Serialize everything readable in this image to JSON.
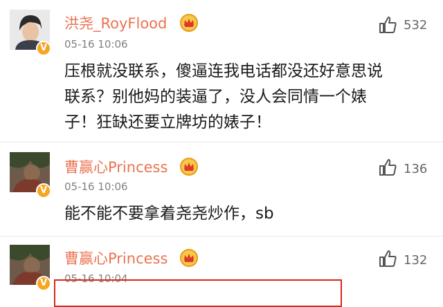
{
  "comments": [
    {
      "username": "洪尧_RoyFlood",
      "time": "05-16 10:06",
      "likes": "532",
      "text_lines": [
        "压根就没联系，傻逼连我电话都没还好意思说",
        "联系？别他妈的装逼了，没人会同情一个婊",
        "子！狂缺还要立牌坊的婊子！"
      ],
      "verified_icon": "verified-v-badge",
      "vip_icon": "crown-badge-icon"
    },
    {
      "username": "曹赢心Princess",
      "time": "05-16 10:06",
      "likes": "136",
      "text_lines": [
        "能不能不要拿着尧尧炒作，sb"
      ],
      "verified_icon": "verified-v-badge",
      "vip_icon": "crown-badge-icon"
    },
    {
      "username": "曹赢心Princess",
      "time": "05-16 10:04",
      "likes": "132",
      "text_lines": [],
      "verified_icon": "verified-v-badge",
      "vip_icon": "crown-badge-icon"
    }
  ],
  "badge_letter": "V",
  "colors": {
    "username": "#eb7350",
    "highlight_box": "#d9261c",
    "verified": "#f5a623"
  }
}
